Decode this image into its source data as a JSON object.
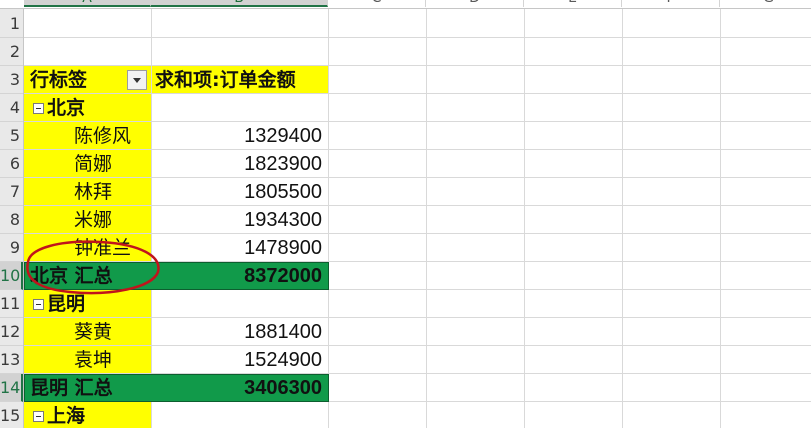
{
  "columns": [
    "A",
    "B",
    "C",
    "D",
    "E",
    "F",
    "G"
  ],
  "rows": [
    "1",
    "2",
    "3",
    "4",
    "5",
    "6",
    "7",
    "8",
    "9",
    "10",
    "11",
    "12",
    "13",
    "14",
    "15"
  ],
  "pivot": {
    "row_labels_header": "行标签",
    "value_header": "求和项:订单金额",
    "groups": [
      {
        "name": "北京",
        "items": [
          {
            "name": "陈修风",
            "value": "1329400"
          },
          {
            "name": "简娜",
            "value": "1823900"
          },
          {
            "name": "林拜",
            "value": "1805500"
          },
          {
            "name": "米娜",
            "value": "1934300"
          },
          {
            "name": "钟准兰",
            "value": "1478900"
          }
        ],
        "subtotal_label": "北京 汇总",
        "subtotal_value": "8372000"
      },
      {
        "name": "昆明",
        "items": [
          {
            "name": "葵黄",
            "value": "1881400"
          },
          {
            "name": "袁坤",
            "value": "1524900"
          }
        ],
        "subtotal_label": "昆明 汇总",
        "subtotal_value": "3406300"
      },
      {
        "name": "上海",
        "items": []
      }
    ]
  },
  "colors": {
    "header_fill": "#ffff00",
    "subtotal_fill": "#119a4a",
    "annotation": "#c0141c",
    "excel_green": "#217346"
  }
}
